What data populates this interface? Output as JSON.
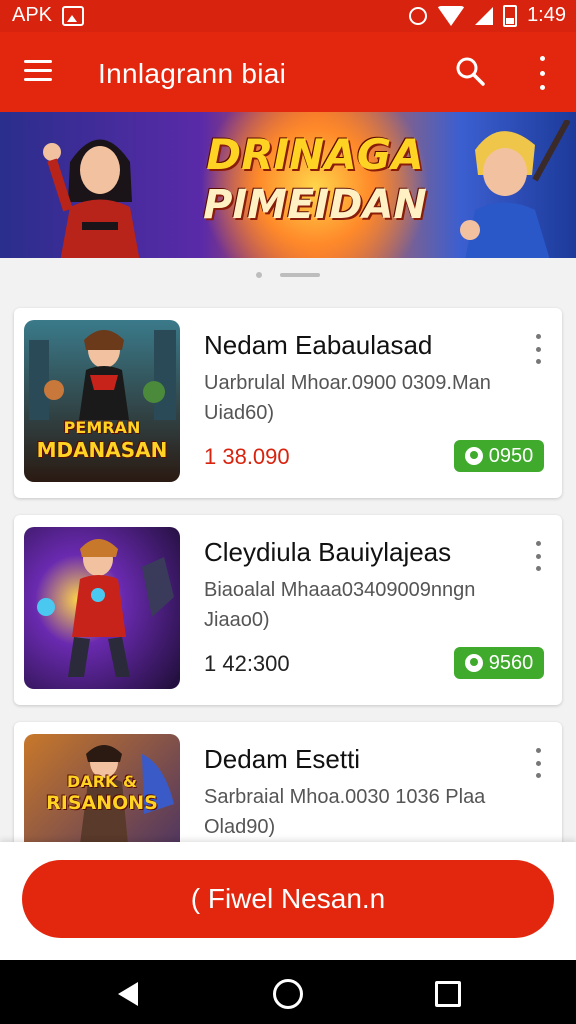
{
  "status_bar": {
    "carrier": "APK",
    "time": "1:49",
    "icons": [
      "notification-icon",
      "alarm-icon",
      "wifi-icon",
      "signal-icon",
      "battery-icon"
    ]
  },
  "app_bar": {
    "title": "Innlagrann biai",
    "icons": [
      "menu-icon",
      "search-icon",
      "more-vert-icon"
    ]
  },
  "banner": {
    "line1": "DRINAGA",
    "line2": "PIMEIDAN"
  },
  "carousel": {
    "page_count": 2,
    "active_index": 1
  },
  "cards": [
    {
      "title": "Nedam Eabaulasad",
      "subtitle": "Uarbrulal Mhoar.0900 0309.Man",
      "subtitle2": "Uiad60)",
      "price": "1 38.090",
      "badge": "0950",
      "thumb_line1": "PEMRAN",
      "thumb_line2": "MDANASAN",
      "colors": {
        "top": "#3a7a8a",
        "bottom": "#2a1a12",
        "accent": "#ffb02a"
      }
    },
    {
      "title": "Cleydiula Bauiylajeas",
      "subtitle": "Biaoalal Mhaaa03409009nngn",
      "subtitle2": "Jiaao0)",
      "price": "1 42:300",
      "badge": "9560",
      "thumb_line1": "",
      "thumb_line2": "",
      "colors": {
        "top": "#6a2ab0",
        "bottom": "#241040",
        "accent": "#e03a2a"
      }
    },
    {
      "title": "Dedam Esetti",
      "subtitle": "Sarbraial Mhoa.0030 1036 Plaa",
      "subtitle2": "Olad90)",
      "price": "",
      "badge": "",
      "thumb_line1": "DARK &",
      "thumb_line2": "RISANONS",
      "colors": {
        "top": "#c8782a",
        "bottom": "#3a2a6a",
        "accent": "#ffd324"
      }
    }
  ],
  "cta": {
    "label": "( Fiwel Nesan.n"
  },
  "nav_bar": {
    "icons": [
      "back-icon",
      "home-icon",
      "recents-icon"
    ]
  },
  "colors": {
    "primary": "#e3270e",
    "badge_green": "#3faa2c",
    "price_red": "#d8230f"
  }
}
